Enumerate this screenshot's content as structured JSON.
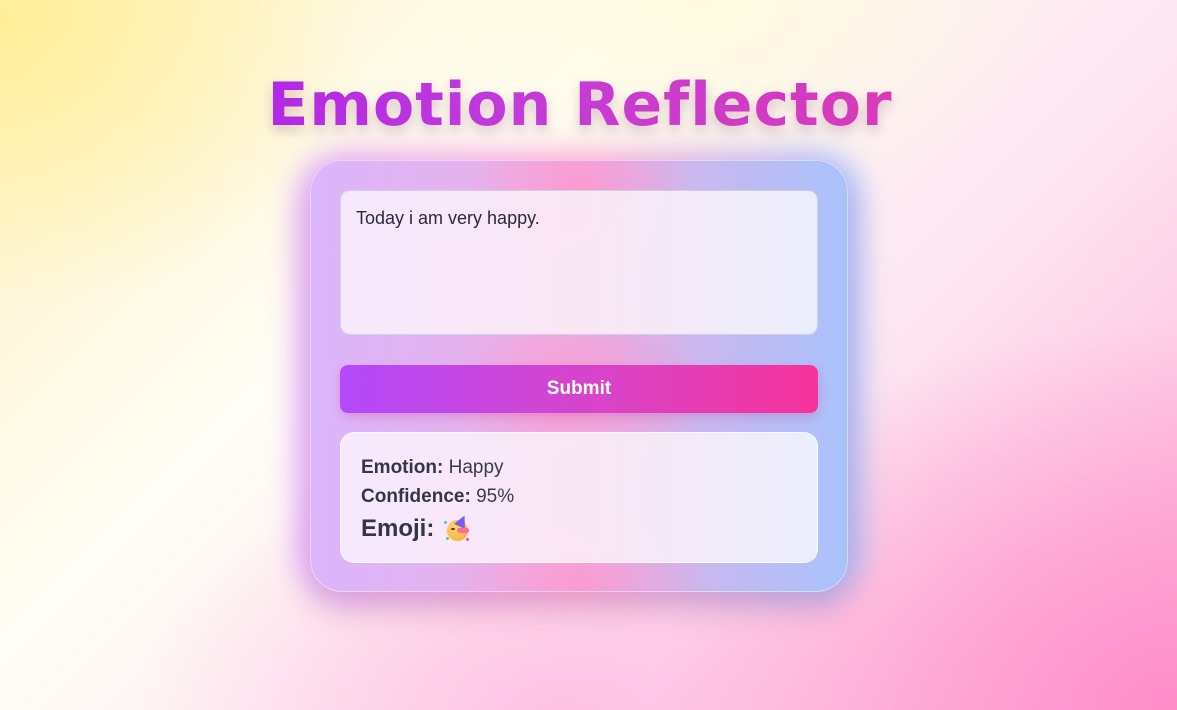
{
  "app": {
    "title": "Emotion Reflector"
  },
  "input": {
    "value": "Today i am very happy.",
    "placeholder": ""
  },
  "submit": {
    "label": "Submit"
  },
  "result": {
    "emotion_label": "Emotion:",
    "emotion_value": "Happy",
    "confidence_label": "Confidence:",
    "confidence_value": "95%",
    "emoji_label": "Emoji:",
    "emoji_icon": "partying-face-icon"
  },
  "colors": {
    "title_gradient_start": "#a413f2",
    "title_gradient_end": "#ea3a9f",
    "button_gradient_start": "#b449fb",
    "button_gradient_end": "#f5339a",
    "card_left": "#dcb5fb",
    "card_right": "#a9c2fb"
  }
}
